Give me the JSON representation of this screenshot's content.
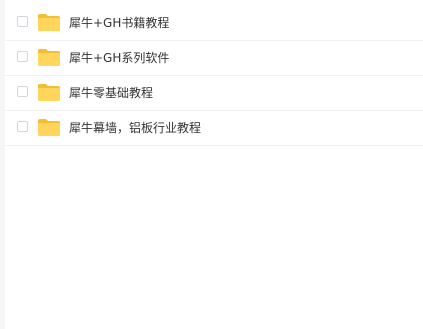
{
  "files": [
    {
      "name": "犀牛+GH书籍教程",
      "icon": "folder-icon",
      "checked": false
    },
    {
      "name": "犀牛+GH系列软件",
      "icon": "folder-icon",
      "checked": false
    },
    {
      "name": "犀牛零基础教程",
      "icon": "folder-icon",
      "checked": false
    },
    {
      "name": "犀牛幕墙，铝板行业教程",
      "icon": "folder-icon",
      "checked": false
    }
  ],
  "colors": {
    "folder": "#ffd65b",
    "folder_tab": "#f3be34",
    "text": "#333333",
    "divider": "#f1f2f4"
  }
}
